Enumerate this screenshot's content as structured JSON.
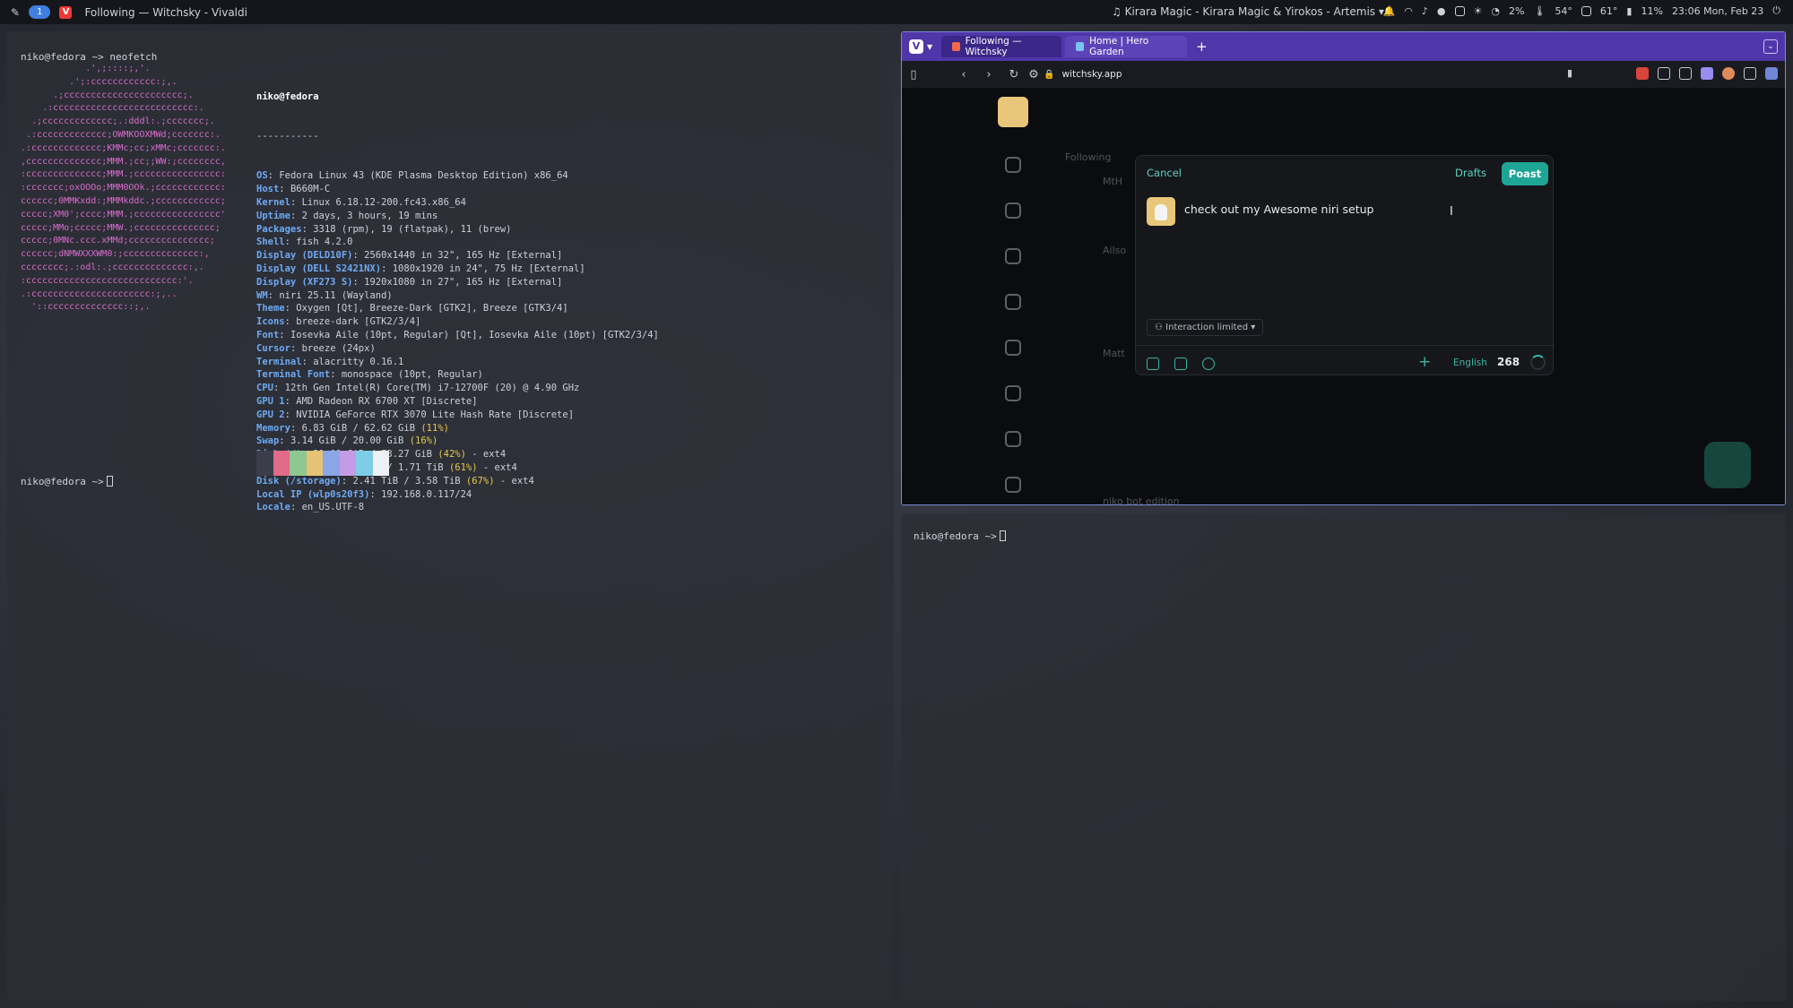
{
  "topbar": {
    "workspace": "1",
    "window_title": "Following — Witchsky - Vivaldi",
    "now_playing": "Kirara Magic - Kirara Magic & Yirokos - Artemis",
    "tray": {
      "cpu": "2%",
      "temp": "54°",
      "gpu_temp": "61°",
      "battery": "11%"
    },
    "clock": "23:06 Mon, Feb 23"
  },
  "terminal_left": {
    "command_line": "niko@fedora ~> neofetch",
    "final_prompt": "niko@fedora ~>",
    "userhost": "niko@fedora",
    "separator": "-----------",
    "ascii": [
      "            .',;::::;,'.",
      "         .';:cccccccccccc:;,.",
      "      .;cccccccccccccccccccccc;.",
      "    .:cccccccccccccccccccccccccc:.",
      "  .;ccccccccccccc;.:dddl:.;ccccccc;.",
      " .:ccccccccccccc;OWMKOOXMWd;ccccccc:.",
      ".:ccccccccccccc;KMMc;cc;xMMc;ccccccc:.",
      ",cccccccccccccc;MMM.;cc;;WW:;cccccccc,",
      ":cccccccccccccc;MMM.;cccccccccccccccc:",
      ":ccccccc;oxOOOo;MMM0OOk.;cccccccccccc:",
      "cccccc;0MMKxdd:;MMMkddc.;cccccccccccc;",
      "ccccc;XM0';cccc;MMM.;cccccccccccccccc'",
      "ccccc;MMo;ccccc;MMW.;ccccccccccccccc;",
      "ccccc;0MNc.ccc.xMMd;ccccccccccccccc;",
      "cccccc;dNMWXXXWM0:;cccccccccccccc:,",
      "cccccccc;.:odl:.;cccccccccccccc:,.",
      ":cccccccccccccccccccccccccccc:'.",
      ".:cccccccccccccccccccccc:;,..",
      "  '::cccccccccccccc::;,."
    ],
    "info": [
      {
        "k": "OS",
        "v": "Fedora Linux 43 (KDE Plasma Desktop Edition) x86_64"
      },
      {
        "k": "Host",
        "v": "B660M-C"
      },
      {
        "k": "Kernel",
        "v": "Linux 6.18.12-200.fc43.x86_64"
      },
      {
        "k": "Uptime",
        "v": "2 days, 3 hours, 19 mins"
      },
      {
        "k": "Packages",
        "v": "3318 (rpm), 19 (flatpak), 11 (brew)"
      },
      {
        "k": "Shell",
        "v": "fish 4.2.0"
      },
      {
        "k": "Display (DELD10F)",
        "v": "2560x1440 in 32\", 165 Hz [External]"
      },
      {
        "k": "Display (DELL S2421NX)",
        "v": "1080x1920 in 24\", 75 Hz [External]"
      },
      {
        "k": "Display (XF273 S)",
        "v": "1920x1080 in 27\", 165 Hz [External]"
      },
      {
        "k": "WM",
        "v": "niri 25.11 (Wayland)"
      },
      {
        "k": "Theme",
        "v": "Oxygen [Qt], Breeze-Dark [GTK2], Breeze [GTK3/4]"
      },
      {
        "k": "Icons",
        "v": "breeze-dark [GTK2/3/4]"
      },
      {
        "k": "Font",
        "v": "Iosevka Aile (10pt, Regular) [Qt], Iosevka Aile (10pt) [GTK2/3/4]"
      },
      {
        "k": "Cursor",
        "v": "breeze (24px)"
      },
      {
        "k": "Terminal",
        "v": "alacritty 0.16.1"
      },
      {
        "k": "Terminal Font",
        "v": "monospace (10pt, Regular)"
      },
      {
        "k": "CPU",
        "v": "12th Gen Intel(R) Core(TM) i7-12700F (20) @ 4.90 GHz"
      },
      {
        "k": "GPU 1",
        "v": "AMD Radeon RX 6700 XT [Discrete]"
      },
      {
        "k": "GPU 2",
        "v": "NVIDIA GeForce RTX 3070 Lite Hash Rate [Discrete]"
      },
      {
        "k": "Memory",
        "v": "6.83 GiB / 62.62 GiB",
        "p": "(11%)"
      },
      {
        "k": "Swap",
        "v": "3.14 GiB / 20.00 GiB",
        "p": "(16%)"
      },
      {
        "k": "Disk (/)",
        "v": "31.09 GiB / 73.27 GiB",
        "p": "(42%)",
        "s": "- ext4"
      },
      {
        "k": "Disk (/home)",
        "v": "1.04 TiB / 1.71 TiB",
        "p": "(61%)",
        "s": "- ext4"
      },
      {
        "k": "Disk (/storage)",
        "v": "2.41 TiB / 3.58 TiB",
        "p": "(67%)",
        "s": "- ext4"
      },
      {
        "k": "Local IP (wlp0s20f3)",
        "v": "192.168.0.117/24"
      },
      {
        "k": "Locale",
        "v": "en_US.UTF-8"
      }
    ],
    "palette": [
      "#3b3e4a",
      "#e26b8a",
      "#8fc792",
      "#e6c277",
      "#8aa6e6",
      "#c39be6",
      "#7fcce6",
      "#eef0f5"
    ]
  },
  "terminal_bottom_right": {
    "prompt": "niko@fedora ~>"
  },
  "browser": {
    "tabs": [
      {
        "label": "Following — Witchsky",
        "active": true,
        "favicon_color": "#f06a4c"
      },
      {
        "label": "Home | Hero Garden",
        "active": false,
        "favicon_color": "#7ac3f0"
      }
    ],
    "url": "witchsky.app",
    "page": {
      "feed_tab": "Following",
      "feed_items": [
        "MtH",
        "Ailso",
        "Matt",
        "niko bot edition"
      ]
    },
    "dialog": {
      "cancel": "Cancel",
      "drafts": "Drafts",
      "post": "Poast",
      "text": "check  out my Awesome niri setup",
      "interaction": "Interaction limited",
      "language": "English",
      "chars_left": "268"
    }
  }
}
